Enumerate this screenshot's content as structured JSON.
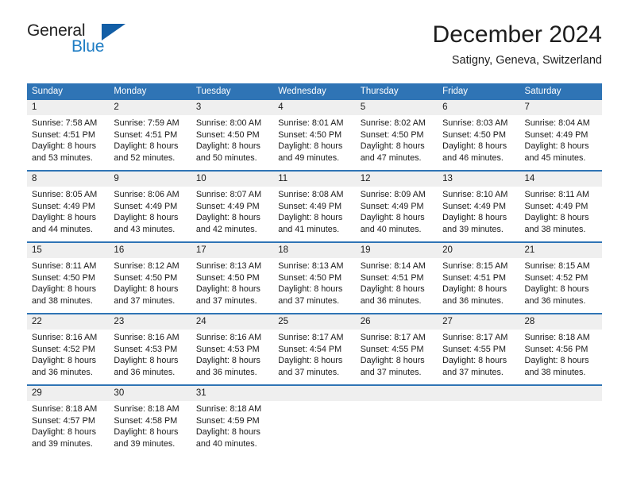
{
  "brand": {
    "name_part1": "General",
    "name_part2": "Blue",
    "logo_icon": "triangle-logo-icon"
  },
  "header": {
    "title": "December 2024",
    "subtitle": "Satigny, Geneva, Switzerland"
  },
  "calendar": {
    "weekday_headers": [
      "Sunday",
      "Monday",
      "Tuesday",
      "Wednesday",
      "Thursday",
      "Friday",
      "Saturday"
    ],
    "accent_color": "#2f74b5",
    "daynum_background": "#efefef",
    "weeks": [
      [
        {
          "day": "1",
          "sunrise": "Sunrise: 7:58 AM",
          "sunset": "Sunset: 4:51 PM",
          "daylight_line1": "Daylight: 8 hours",
          "daylight_line2": "and 53 minutes."
        },
        {
          "day": "2",
          "sunrise": "Sunrise: 7:59 AM",
          "sunset": "Sunset: 4:51 PM",
          "daylight_line1": "Daylight: 8 hours",
          "daylight_line2": "and 52 minutes."
        },
        {
          "day": "3",
          "sunrise": "Sunrise: 8:00 AM",
          "sunset": "Sunset: 4:50 PM",
          "daylight_line1": "Daylight: 8 hours",
          "daylight_line2": "and 50 minutes."
        },
        {
          "day": "4",
          "sunrise": "Sunrise: 8:01 AM",
          "sunset": "Sunset: 4:50 PM",
          "daylight_line1": "Daylight: 8 hours",
          "daylight_line2": "and 49 minutes."
        },
        {
          "day": "5",
          "sunrise": "Sunrise: 8:02 AM",
          "sunset": "Sunset: 4:50 PM",
          "daylight_line1": "Daylight: 8 hours",
          "daylight_line2": "and 47 minutes."
        },
        {
          "day": "6",
          "sunrise": "Sunrise: 8:03 AM",
          "sunset": "Sunset: 4:50 PM",
          "daylight_line1": "Daylight: 8 hours",
          "daylight_line2": "and 46 minutes."
        },
        {
          "day": "7",
          "sunrise": "Sunrise: 8:04 AM",
          "sunset": "Sunset: 4:49 PM",
          "daylight_line1": "Daylight: 8 hours",
          "daylight_line2": "and 45 minutes."
        }
      ],
      [
        {
          "day": "8",
          "sunrise": "Sunrise: 8:05 AM",
          "sunset": "Sunset: 4:49 PM",
          "daylight_line1": "Daylight: 8 hours",
          "daylight_line2": "and 44 minutes."
        },
        {
          "day": "9",
          "sunrise": "Sunrise: 8:06 AM",
          "sunset": "Sunset: 4:49 PM",
          "daylight_line1": "Daylight: 8 hours",
          "daylight_line2": "and 43 minutes."
        },
        {
          "day": "10",
          "sunrise": "Sunrise: 8:07 AM",
          "sunset": "Sunset: 4:49 PM",
          "daylight_line1": "Daylight: 8 hours",
          "daylight_line2": "and 42 minutes."
        },
        {
          "day": "11",
          "sunrise": "Sunrise: 8:08 AM",
          "sunset": "Sunset: 4:49 PM",
          "daylight_line1": "Daylight: 8 hours",
          "daylight_line2": "and 41 minutes."
        },
        {
          "day": "12",
          "sunrise": "Sunrise: 8:09 AM",
          "sunset": "Sunset: 4:49 PM",
          "daylight_line1": "Daylight: 8 hours",
          "daylight_line2": "and 40 minutes."
        },
        {
          "day": "13",
          "sunrise": "Sunrise: 8:10 AM",
          "sunset": "Sunset: 4:49 PM",
          "daylight_line1": "Daylight: 8 hours",
          "daylight_line2": "and 39 minutes."
        },
        {
          "day": "14",
          "sunrise": "Sunrise: 8:11 AM",
          "sunset": "Sunset: 4:49 PM",
          "daylight_line1": "Daylight: 8 hours",
          "daylight_line2": "and 38 minutes."
        }
      ],
      [
        {
          "day": "15",
          "sunrise": "Sunrise: 8:11 AM",
          "sunset": "Sunset: 4:50 PM",
          "daylight_line1": "Daylight: 8 hours",
          "daylight_line2": "and 38 minutes."
        },
        {
          "day": "16",
          "sunrise": "Sunrise: 8:12 AM",
          "sunset": "Sunset: 4:50 PM",
          "daylight_line1": "Daylight: 8 hours",
          "daylight_line2": "and 37 minutes."
        },
        {
          "day": "17",
          "sunrise": "Sunrise: 8:13 AM",
          "sunset": "Sunset: 4:50 PM",
          "daylight_line1": "Daylight: 8 hours",
          "daylight_line2": "and 37 minutes."
        },
        {
          "day": "18",
          "sunrise": "Sunrise: 8:13 AM",
          "sunset": "Sunset: 4:50 PM",
          "daylight_line1": "Daylight: 8 hours",
          "daylight_line2": "and 37 minutes."
        },
        {
          "day": "19",
          "sunrise": "Sunrise: 8:14 AM",
          "sunset": "Sunset: 4:51 PM",
          "daylight_line1": "Daylight: 8 hours",
          "daylight_line2": "and 36 minutes."
        },
        {
          "day": "20",
          "sunrise": "Sunrise: 8:15 AM",
          "sunset": "Sunset: 4:51 PM",
          "daylight_line1": "Daylight: 8 hours",
          "daylight_line2": "and 36 minutes."
        },
        {
          "day": "21",
          "sunrise": "Sunrise: 8:15 AM",
          "sunset": "Sunset: 4:52 PM",
          "daylight_line1": "Daylight: 8 hours",
          "daylight_line2": "and 36 minutes."
        }
      ],
      [
        {
          "day": "22",
          "sunrise": "Sunrise: 8:16 AM",
          "sunset": "Sunset: 4:52 PM",
          "daylight_line1": "Daylight: 8 hours",
          "daylight_line2": "and 36 minutes."
        },
        {
          "day": "23",
          "sunrise": "Sunrise: 8:16 AM",
          "sunset": "Sunset: 4:53 PM",
          "daylight_line1": "Daylight: 8 hours",
          "daylight_line2": "and 36 minutes."
        },
        {
          "day": "24",
          "sunrise": "Sunrise: 8:16 AM",
          "sunset": "Sunset: 4:53 PM",
          "daylight_line1": "Daylight: 8 hours",
          "daylight_line2": "and 36 minutes."
        },
        {
          "day": "25",
          "sunrise": "Sunrise: 8:17 AM",
          "sunset": "Sunset: 4:54 PM",
          "daylight_line1": "Daylight: 8 hours",
          "daylight_line2": "and 37 minutes."
        },
        {
          "day": "26",
          "sunrise": "Sunrise: 8:17 AM",
          "sunset": "Sunset: 4:55 PM",
          "daylight_line1": "Daylight: 8 hours",
          "daylight_line2": "and 37 minutes."
        },
        {
          "day": "27",
          "sunrise": "Sunrise: 8:17 AM",
          "sunset": "Sunset: 4:55 PM",
          "daylight_line1": "Daylight: 8 hours",
          "daylight_line2": "and 37 minutes."
        },
        {
          "day": "28",
          "sunrise": "Sunrise: 8:18 AM",
          "sunset": "Sunset: 4:56 PM",
          "daylight_line1": "Daylight: 8 hours",
          "daylight_line2": "and 38 minutes."
        }
      ],
      [
        {
          "day": "29",
          "sunrise": "Sunrise: 8:18 AM",
          "sunset": "Sunset: 4:57 PM",
          "daylight_line1": "Daylight: 8 hours",
          "daylight_line2": "and 39 minutes."
        },
        {
          "day": "30",
          "sunrise": "Sunrise: 8:18 AM",
          "sunset": "Sunset: 4:58 PM",
          "daylight_line1": "Daylight: 8 hours",
          "daylight_line2": "and 39 minutes."
        },
        {
          "day": "31",
          "sunrise": "Sunrise: 8:18 AM",
          "sunset": "Sunset: 4:59 PM",
          "daylight_line1": "Daylight: 8 hours",
          "daylight_line2": "and 40 minutes."
        },
        {
          "day": "",
          "sunrise": "",
          "sunset": "",
          "daylight_line1": "",
          "daylight_line2": ""
        },
        {
          "day": "",
          "sunrise": "",
          "sunset": "",
          "daylight_line1": "",
          "daylight_line2": ""
        },
        {
          "day": "",
          "sunrise": "",
          "sunset": "",
          "daylight_line1": "",
          "daylight_line2": ""
        },
        {
          "day": "",
          "sunrise": "",
          "sunset": "",
          "daylight_line1": "",
          "daylight_line2": ""
        }
      ]
    ]
  }
}
